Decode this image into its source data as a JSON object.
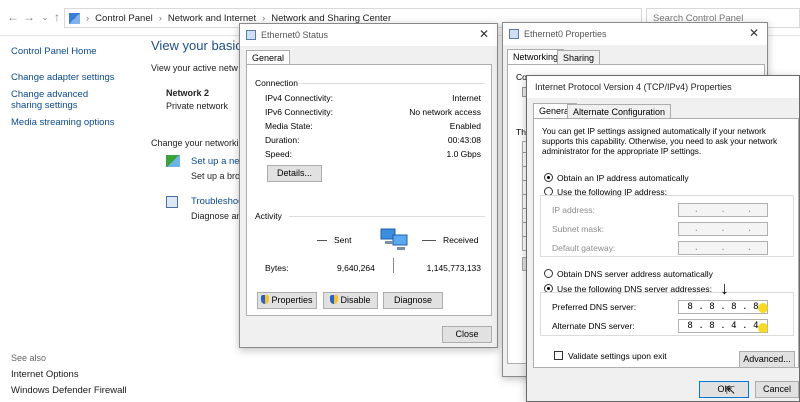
{
  "explorer": {
    "breadcrumb": [
      "Control Panel",
      "Network and Internet",
      "Network and Sharing Center"
    ],
    "search_placeholder": "Search Control Panel",
    "left_links": [
      "Control Panel Home",
      "Change adapter settings",
      "Change advanced sharing settings",
      "Media streaming options"
    ],
    "see_also_label": "See also",
    "see_also_links": [
      "Internet Options",
      "Windows Defender Firewall"
    ],
    "main_title": "View your basic n",
    "active_networks_label": "View your active netw",
    "network_name": "Network 2",
    "network_type": "Private network",
    "change_settings_label": "Change your networkin",
    "setup_link": "Set up a new",
    "setup_desc": "Set up a broa",
    "troubleshoot_link": "Troubleshoot",
    "troubleshoot_desc": "Diagnose and"
  },
  "status_window": {
    "title": "Ethernet0 Status",
    "tab": "General",
    "connection_label": "Connection",
    "rows": [
      {
        "label": "IPv4 Connectivity:",
        "value": "Internet"
      },
      {
        "label": "IPv6 Connectivity:",
        "value": "No network access"
      },
      {
        "label": "Media State:",
        "value": "Enabled"
      },
      {
        "label": "Duration:",
        "value": "00:43:08"
      },
      {
        "label": "Speed:",
        "value": "1.0 Gbps"
      }
    ],
    "details_btn": "Details...",
    "activity_label": "Activity",
    "sent_label": "Sent",
    "received_label": "Received",
    "bytes_label": "Bytes:",
    "bytes_sent": "9,640,264",
    "bytes_received": "1,145,773,133",
    "properties_btn": "Properties",
    "disable_btn": "Disable",
    "diagnose_btn": "Diagnose",
    "close_btn": "Close"
  },
  "props_window": {
    "title": "Ethernet0 Properties",
    "tabs": [
      "Networking",
      "Sharing"
    ],
    "connect_label": "Conne",
    "this_label": "Th"
  },
  "ipv4_window": {
    "title": "Internet Protocol Version 4 (TCP/IPv4) Properties",
    "tabs": [
      "General",
      "Alternate Configuration"
    ],
    "description": "You can get IP settings assigned automatically if your network supports this capability. Otherwise, you need to ask your network administrator for the appropriate IP settings.",
    "obtain_ip_auto": "Obtain an IP address automatically",
    "use_following_ip": "Use the following IP address:",
    "ip_address_label": "IP address:",
    "subnet_label": "Subnet mask:",
    "gateway_label": "Default gateway:",
    "obtain_dns_auto": "Obtain DNS server address automatically",
    "use_following_dns": "Use the following DNS server addresses:",
    "preferred_dns_label": "Preferred DNS server:",
    "alternate_dns_label": "Alternate DNS server:",
    "preferred_dns": [
      "8",
      "8",
      "8",
      "8"
    ],
    "alternate_dns": [
      "8",
      "8",
      "4",
      "4"
    ],
    "validate_label": "Validate settings upon exit",
    "advanced_btn": "Advanced...",
    "ok_btn": "OK",
    "cancel_btn": "Cancel"
  }
}
